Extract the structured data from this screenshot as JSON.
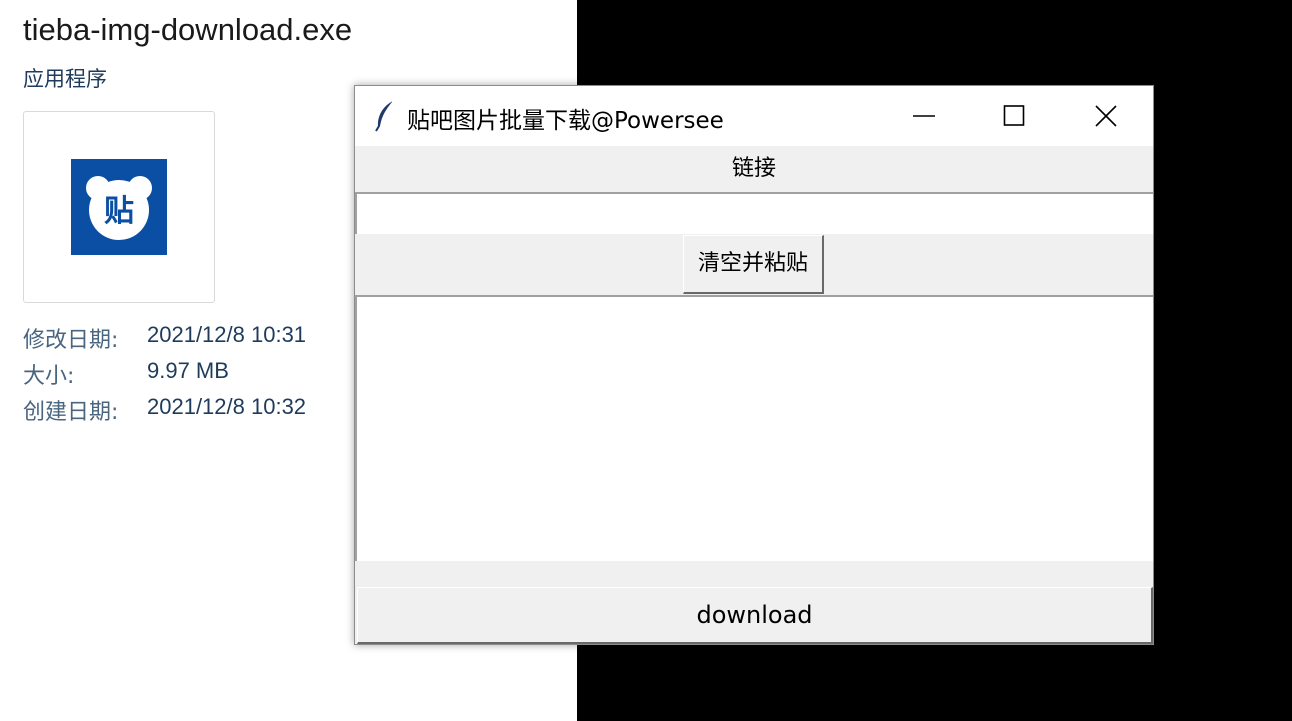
{
  "file_info": {
    "file_name": "tieba-img-download.exe",
    "file_type": "应用程序",
    "icon": "tieba-app-icon",
    "icon_color": "#0a4fa3",
    "icon_glyph": "贴",
    "meta": [
      {
        "label": "修改日期:",
        "value": "2021/12/8 10:31"
      },
      {
        "label": "大小:",
        "value": "9.97 MB"
      },
      {
        "label": "创建日期:",
        "value": "2021/12/8 10:32"
      }
    ]
  },
  "window": {
    "title": "贴吧图片批量下载@Powersee",
    "title_icon": "feather-icon",
    "link_label": "链接",
    "link_input_value": "",
    "paste_button_label": "清空并粘贴",
    "output_text": "",
    "download_button_label": "download"
  }
}
